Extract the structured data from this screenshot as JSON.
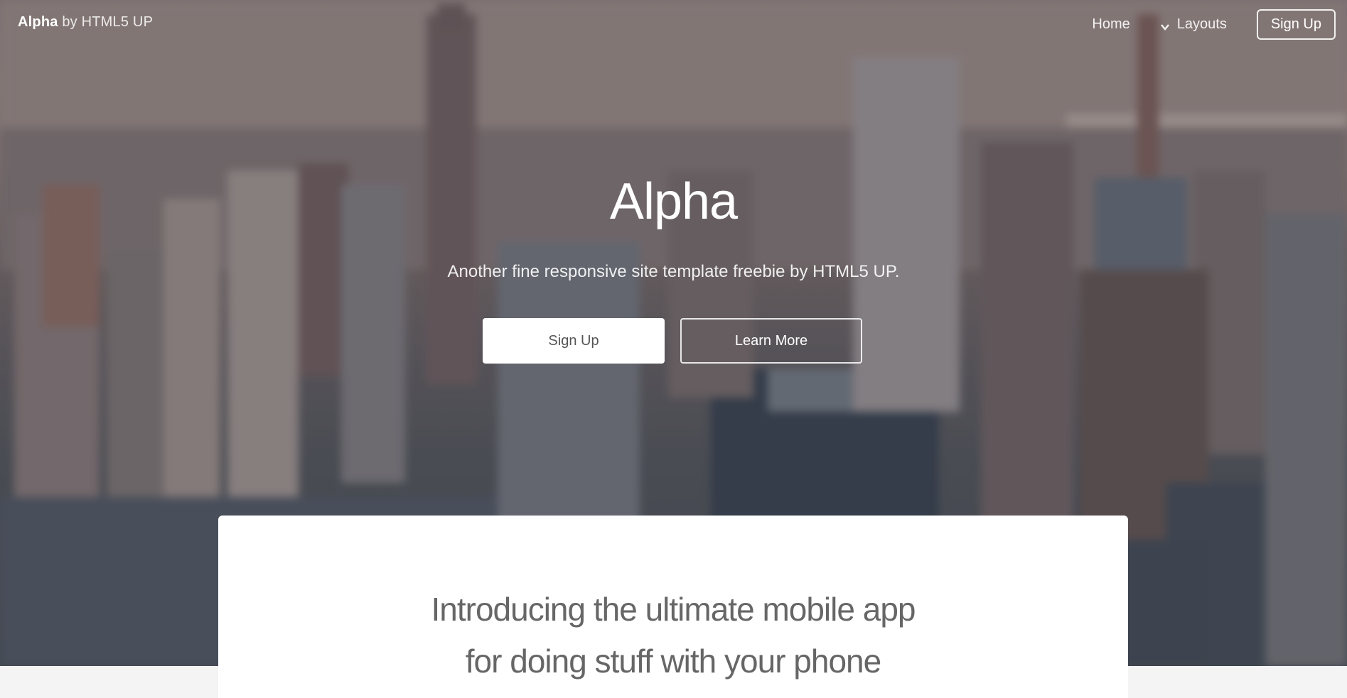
{
  "header": {
    "logo_brand": "Alpha",
    "logo_suffix": "by HTML5 UP",
    "nav": {
      "home_label": "Home",
      "layouts_label": "Layouts",
      "signup_label": "Sign Up"
    }
  },
  "hero": {
    "title": "Alpha",
    "subtitle": "Another fine responsive site template freebie by HTML5 UP.",
    "primary_button": "Sign Up",
    "secondary_button": "Learn More"
  },
  "intro": {
    "line1": "Introducing the ultimate mobile app",
    "line2": "for doing stuff with your phone"
  },
  "icons": {
    "layouts_dropdown": "chevron-down-icon"
  },
  "colors": {
    "accent": "#ffffff",
    "card_text": "#666666",
    "page_background": "#f4f4f4"
  }
}
